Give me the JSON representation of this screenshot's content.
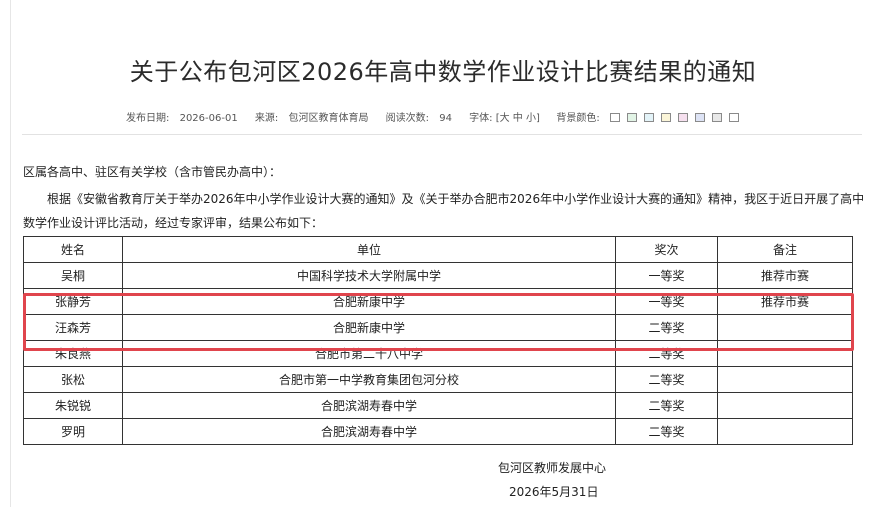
{
  "article": {
    "title": "关于公布包河区2026年高中数学作业设计比赛结果的通知",
    "meta": {
      "publish_date_label": "发布日期:",
      "publish_date": "2026-06-01",
      "source_label": "来源:",
      "source": "包河区教育体育局",
      "views_label": "阅读次数:",
      "views": "94",
      "font_label": "字体:",
      "font_open": "[",
      "font_large": "大",
      "font_medium": "中",
      "font_small": "小",
      "font_close": "]",
      "bg_label": "背景颜色:",
      "bg_colors": [
        "#ffffff",
        "#e2f4e6",
        "#e3f3f8",
        "#fbf5d8",
        "#f6e0ef",
        "#dde3f5",
        "#e8e8e8",
        "#ffffff"
      ]
    },
    "salutation": "区属各高中、驻区有关学校（含市管民办高中）：",
    "paragraph": "根据《安徽省教育厅关于举办2026年中小学作业设计大赛的通知》及《关于举办合肥市2026年中小学作业设计大赛的通知》精神，我区于近日开展了高中数学作业设计评比活动，经过专家评审，结果公布如下：",
    "table": {
      "headers": [
        "姓名",
        "单位",
        "奖次",
        "备注"
      ],
      "rows": [
        [
          "吴桐",
          "中国科学技术大学附属中学",
          "一等奖",
          "推荐市赛"
        ],
        [
          "张静芳",
          "合肥新康中学",
          "一等奖",
          "推荐市赛"
        ],
        [
          "汪森芳",
          "合肥新康中学",
          "二等奖",
          ""
        ],
        [
          "朱良燕",
          "合肥市第二十八中学",
          "二等奖",
          ""
        ],
        [
          "张松",
          "合肥市第一中学教育集团包河分校",
          "二等奖",
          ""
        ],
        [
          "朱锐锐",
          "合肥滨湖寿春中学",
          "二等奖",
          ""
        ],
        [
          "罗明",
          "合肥滨湖寿春中学",
          "二等奖",
          ""
        ]
      ]
    },
    "issuer": "包河区教师发展中心",
    "issue_date": "2026年5月31日"
  }
}
